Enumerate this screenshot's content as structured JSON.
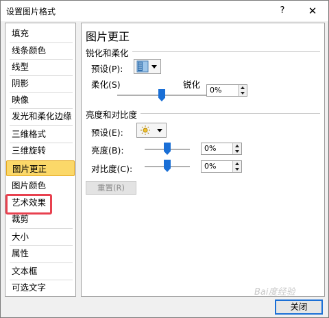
{
  "window": {
    "title": "设置图片格式",
    "help_label": "?",
    "close_label": "✕"
  },
  "sidebar": {
    "items": [
      {
        "label": "填充"
      },
      {
        "label": "线条颜色"
      },
      {
        "label": "线型"
      },
      {
        "label": "阴影"
      },
      {
        "label": "映像"
      },
      {
        "label": "发光和柔化边缘"
      },
      {
        "label": "三维格式"
      },
      {
        "label": "三维旋转"
      },
      {
        "label": "图片更正",
        "selected": true
      },
      {
        "label": "图片颜色"
      },
      {
        "label": "艺术效果",
        "highlighted": true
      },
      {
        "label": "裁剪"
      },
      {
        "label": "大小"
      },
      {
        "label": "属性"
      },
      {
        "label": "文本框"
      },
      {
        "label": "可选文字"
      }
    ]
  },
  "panel": {
    "title": "图片更正",
    "sharpen": {
      "section_title": "锐化和柔化",
      "preset_label": "预设(P):",
      "preset_icon": "sharpen-preset-icon",
      "soften_label": "柔化(S)",
      "sharpen_label": "锐化",
      "slider_value": 0.5,
      "value": "0%"
    },
    "brightness_contrast": {
      "section_title": "亮度和对比度",
      "preset_label": "预设(E):",
      "preset_icon": "sun-icon",
      "brightness_label": "亮度(B):",
      "brightness_slider_value": 0.5,
      "brightness_value": "0%",
      "contrast_label": "对比度(C):",
      "contrast_slider_value": 0.5,
      "contrast_value": "0%"
    },
    "reset_label": "重置(R)"
  },
  "footer": {
    "close_button_label": "关闭"
  },
  "watermark": "Bai度经验",
  "colors": {
    "selected_bg": "#fbd869",
    "selected_border": "#e5a81e",
    "highlight_box": "#e8414f",
    "slider_thumb": "#1a6fd6"
  }
}
